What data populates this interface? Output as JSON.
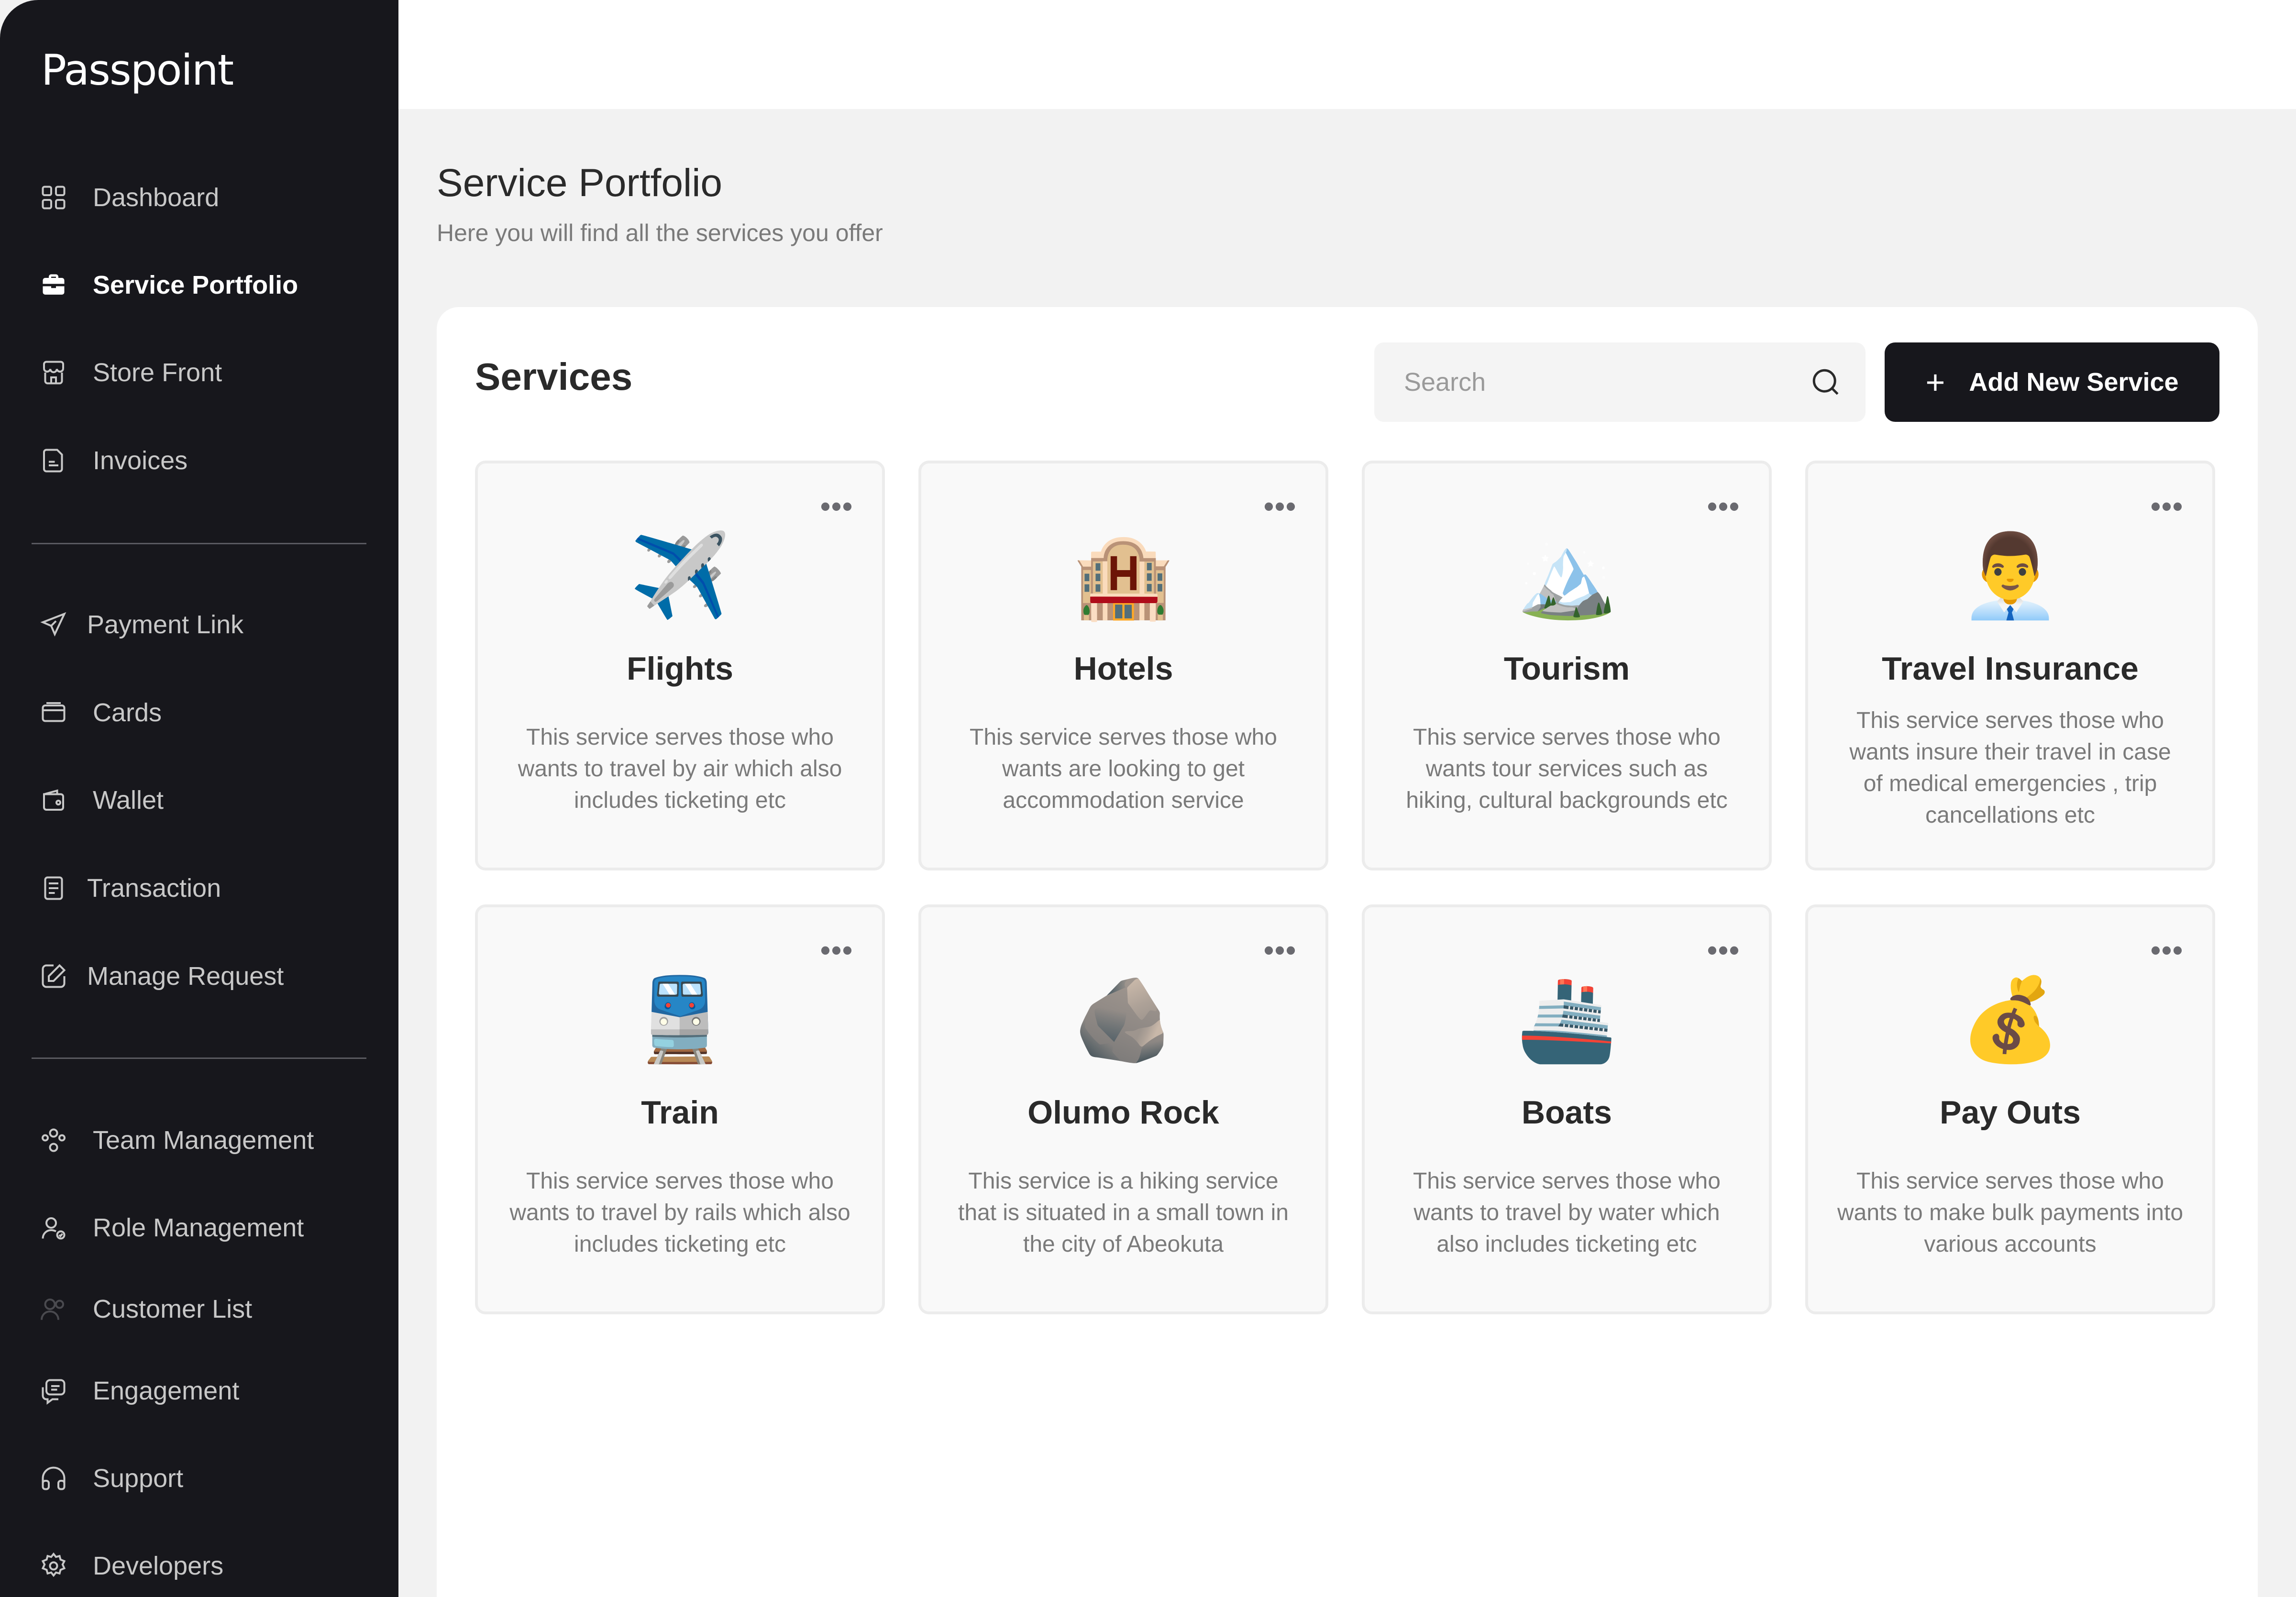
{
  "brand": {
    "logo_text": "Passpoint"
  },
  "sidebar": {
    "items": [
      {
        "label": "Dashboard",
        "icon": "grid-icon"
      },
      {
        "label": "Service Portfolio",
        "icon": "briefcase-icon",
        "active": true
      },
      {
        "label": "Store Front",
        "icon": "storefront-icon"
      },
      {
        "label": "Invoices",
        "icon": "invoice-icon"
      },
      {
        "label": "Payment Link",
        "icon": "send-icon"
      },
      {
        "label": "Cards",
        "icon": "card-icon"
      },
      {
        "label": "Wallet",
        "icon": "wallet-icon"
      },
      {
        "label": "Transaction",
        "icon": "receipt-icon"
      },
      {
        "label": "Manage Request",
        "icon": "edit-icon"
      },
      {
        "label": "Team Management",
        "icon": "team-icon"
      },
      {
        "label": "Role Management",
        "icon": "user-check-icon"
      },
      {
        "label": "Customer List",
        "icon": "users-icon"
      },
      {
        "label": "Engagement",
        "icon": "chat-icon"
      },
      {
        "label": "Support",
        "icon": "headphones-icon"
      },
      {
        "label": "Developers",
        "icon": "gear-icon"
      }
    ]
  },
  "header": {
    "title": "Service Portfolio",
    "subtitle": "Here you will find all the services you offer"
  },
  "services": {
    "title": "Services",
    "search_placeholder": "Search",
    "add_button_label": "Add New Service",
    "cards": [
      {
        "emoji": "✈️",
        "title": "Flights",
        "description": "This service serves those who wants to travel by air which also includes ticketing etc"
      },
      {
        "emoji": "🏨",
        "title": "Hotels",
        "description": "This service serves those who wants are looking to get accommodation service"
      },
      {
        "emoji": "🏔️",
        "title": "Tourism",
        "description": "This service serves those who wants tour services such as hiking, cultural backgrounds etc"
      },
      {
        "emoji": "👨‍💼",
        "title": "Travel Insurance",
        "description": "This service serves those who wants insure their travel in case of medical emergencies , trip cancellations etc"
      },
      {
        "emoji": "🚆",
        "title": "Train",
        "description": "This service serves those who wants to travel by rails which also includes ticketing etc"
      },
      {
        "emoji": "🪨",
        "title": "Olumo Rock",
        "description": "This service is a hiking service that is situated in a small town in the city of Abeokuta"
      },
      {
        "emoji": "🚢",
        "title": "Boats",
        "description": "This service serves those who wants to travel by water which also includes ticketing etc"
      },
      {
        "emoji": "💰",
        "title": "Pay Outs",
        "description": "This service serves those who wants to make bulk payments into various accounts"
      }
    ]
  }
}
